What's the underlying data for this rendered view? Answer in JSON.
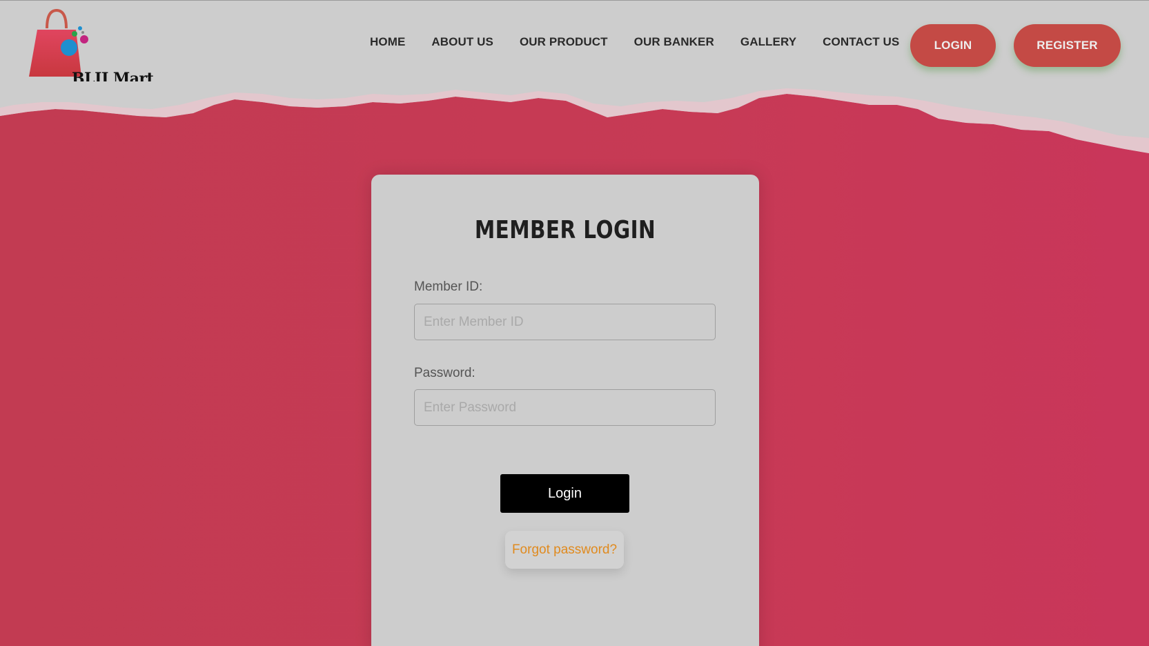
{
  "brand": {
    "name": "BLIJ Mart",
    "colors": {
      "accent": "#c44a45",
      "background": "#c23b52",
      "header": "#cdcdcd",
      "link": "#e08a1e"
    }
  },
  "nav": {
    "items": [
      {
        "label": "HOME"
      },
      {
        "label": "ABOUT US"
      },
      {
        "label": "OUR PRODUCT"
      },
      {
        "label": "OUR BANKER"
      },
      {
        "label": "GALLERY"
      },
      {
        "label": "CONTACT US"
      }
    ],
    "login_label": "LOGIN",
    "register_label": "REGISTER"
  },
  "login_form": {
    "title": "MEMBER LOGIN",
    "member_id": {
      "label": "Member ID:",
      "placeholder": "Enter Member ID",
      "value": ""
    },
    "password": {
      "label": "Password:",
      "placeholder": "Enter Password",
      "value": ""
    },
    "submit_label": "Login",
    "forgot_label": "Forgot password?"
  }
}
